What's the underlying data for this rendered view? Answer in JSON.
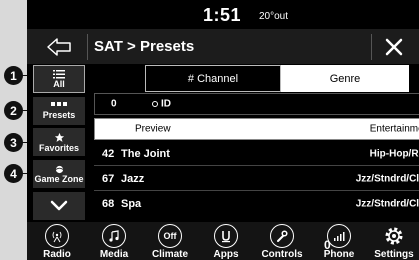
{
  "callouts": [
    "1",
    "2",
    "3",
    "4"
  ],
  "status": {
    "time": "1:51",
    "temperature": "20°out"
  },
  "header": {
    "title": "SAT > Presets",
    "back_icon": "left-arrow-icon",
    "close_icon": "close-icon"
  },
  "sidebar": {
    "items": [
      {
        "label": "All",
        "icon": "list-icon"
      },
      {
        "label": "Presets",
        "icon": "presets-icon"
      },
      {
        "label": "Favorites",
        "icon": "star-icon"
      },
      {
        "label": "Game Zone",
        "icon": "game-zone-icon"
      }
    ],
    "down_icon": "chevron-down-icon"
  },
  "tabs": [
    {
      "label": "# Channel",
      "selected": true
    },
    {
      "label": "Genre",
      "selected": false
    }
  ],
  "current": {
    "number": "0",
    "id_label": "ID"
  },
  "preview": {
    "label": "Preview",
    "genre": "Entertainment"
  },
  "channels": [
    {
      "number": "42",
      "name": "The Joint",
      "genre": "Hip-Hop/R&B"
    },
    {
      "number": "67",
      "name": "Jazz",
      "genre": "Jzz/Stndrd/Clscl"
    },
    {
      "number": "68",
      "name": "Spa",
      "genre": "Jzz/Stndrd/Clscl"
    }
  ],
  "bottom_bar": [
    {
      "label": "Radio",
      "icon": "radio-icon"
    },
    {
      "label": "Media",
      "icon": "music-note-icon"
    },
    {
      "label": "Climate",
      "icon": "climate-icon",
      "icon_text": "Off"
    },
    {
      "label": "Apps",
      "icon": "apps-icon"
    },
    {
      "label": "Controls",
      "icon": "wrench-icon"
    },
    {
      "label": "Phone",
      "icon": "phone-signal-icon",
      "badge": "0"
    },
    {
      "label": "Settings",
      "icon": "gear-icon"
    }
  ],
  "colors": {
    "selected_tab": "#000000",
    "tab": "#ffffff",
    "row_bg": "#000000"
  }
}
